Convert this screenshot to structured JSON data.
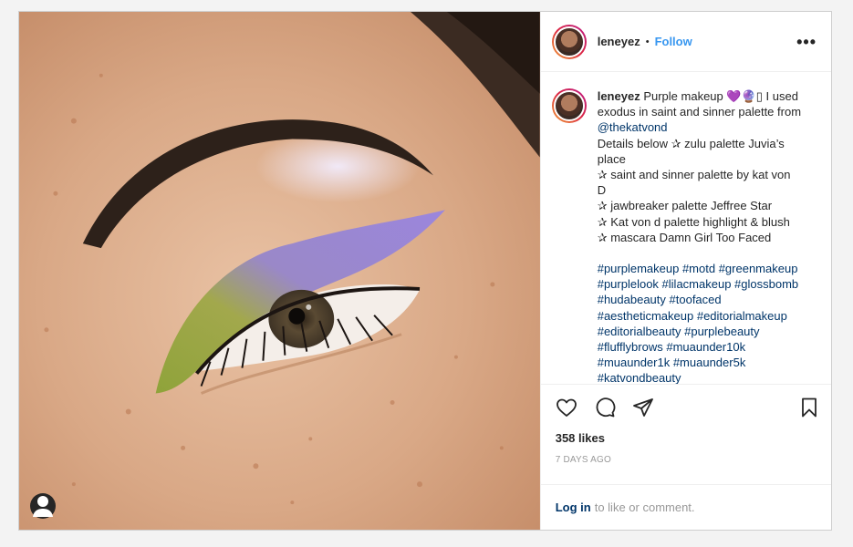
{
  "post": {
    "username": "leneyez",
    "separator": "•",
    "follow_label": "Follow",
    "more_label": "•••",
    "caption": {
      "username": "leneyez",
      "lines": [
        " Purple makeup 💜🔮▯ I used",
        "exodus in saint and sinner palette from"
      ],
      "mention": "@thekatvond",
      "details": [
        "Details below ✰ zulu palette Juvia’s",
        "place",
        "✰ saint and sinner palette by kat von",
        "D",
        "✰ jawbreaker palette Jeffree Star",
        "✰ Kat von d palette highlight & blush",
        "✰ mascara Damn Girl Too Faced"
      ],
      "hashtags": [
        "#purplemakeup #motd #greenmakeup",
        "#purplelook #lilacmakeup #glossbomb",
        "#hudabeauty #toofaced",
        "#aestheticmakeup #editorialmakeup",
        "#editorialbeauty #purplebeauty",
        "#flufflybrows #muaunder10k",
        "#muaunder1k #muaunder5k",
        "#katvondbeauty"
      ]
    },
    "likes": "358 likes",
    "time_ago": "7 DAYS AGO",
    "login_link": "Log in",
    "login_suffix": "to like or comment.",
    "icons": {
      "like": "heart-icon",
      "comment": "comment-icon",
      "share": "share-icon",
      "save": "bookmark-icon",
      "tag": "user-tag-icon"
    },
    "colors": {
      "follow": "#3897f0",
      "link": "#003569",
      "muted": "#999999"
    }
  }
}
